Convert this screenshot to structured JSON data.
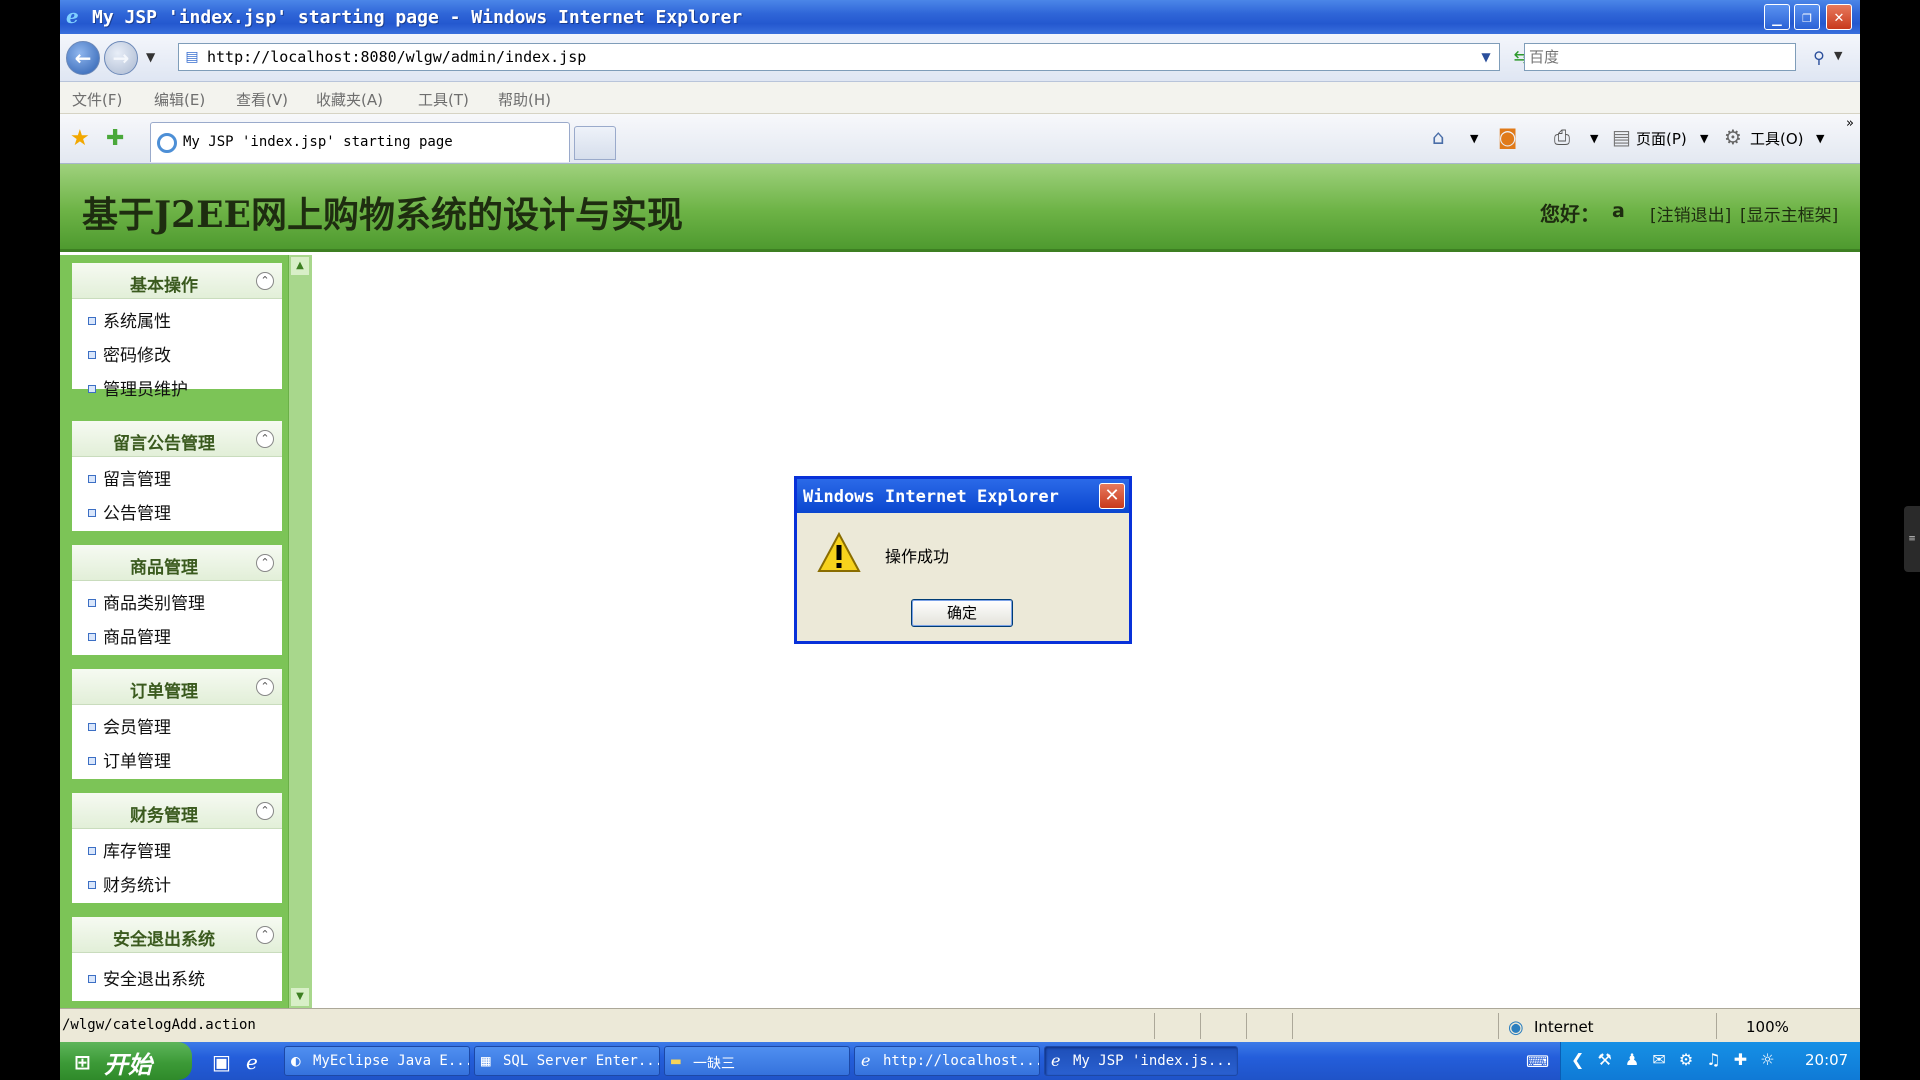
{
  "window": {
    "title": "My JSP 'index.jsp' starting page - Windows Internet Explorer",
    "icon": "ie-icon",
    "min_glyph": "_",
    "max_glyph": "❐",
    "close_glyph": "✕"
  },
  "address_bar": {
    "url": "http://localhost:8080/wlgw/admin/index.jsp",
    "search_placeholder": "百度"
  },
  "menu": [
    "文件(F)",
    "编辑(E)",
    "查看(V)",
    "收藏夹(A)",
    "工具(T)",
    "帮助(H)"
  ],
  "tab": {
    "label": "My JSP 'index.jsp' starting page"
  },
  "command_bar": {
    "page_label": "页面(P)",
    "tools_label": "工具(O)"
  },
  "page": {
    "title": "基于J2EE网上购物系统的设计与实现",
    "greeting": "您好：",
    "user": "a",
    "logout_link": "[注销退出]",
    "frame_link": "[显示主框架]"
  },
  "sidebar": {
    "groups": [
      {
        "title": "基本操作",
        "items": [
          "系统属性",
          "密码修改",
          "管理员维护"
        ]
      },
      {
        "title": "留言公告管理",
        "items": [
          "留言管理",
          "公告管理"
        ]
      },
      {
        "title": "商品管理",
        "items": [
          "商品类别管理",
          "商品管理"
        ]
      },
      {
        "title": "订单管理",
        "items": [
          "会员管理",
          "订单管理"
        ]
      },
      {
        "title": "财务管理",
        "items": [
          "库存管理",
          "财务统计"
        ]
      },
      {
        "title": "安全退出系统",
        "items": [
          "安全退出系统"
        ]
      }
    ]
  },
  "dialog": {
    "title": "Windows Internet Explorer",
    "message": "操作成功",
    "ok_label": "确定"
  },
  "status_bar": {
    "text": "/wlgw/catelogAdd.action",
    "zone": "Internet",
    "zoom": "100%"
  },
  "taskbar": {
    "start_label": "开始",
    "buttons": [
      {
        "label": "MyEclipse Java E...",
        "icon": "eclipse-icon"
      },
      {
        "label": "SQL Server Enter...",
        "icon": "sql-server-icon"
      },
      {
        "label": "一缺三",
        "icon": "folder-icon"
      },
      {
        "label": "http://localhost...",
        "icon": "ie-icon"
      },
      {
        "label": "My JSP 'index.js...",
        "icon": "ie-icon"
      }
    ],
    "clock": "20:07"
  },
  "colors": {
    "header_green": "#6db346",
    "sidebar_green": "#7cc457",
    "xp_blue": "#245edb",
    "dialog_border": "#0831d9"
  }
}
